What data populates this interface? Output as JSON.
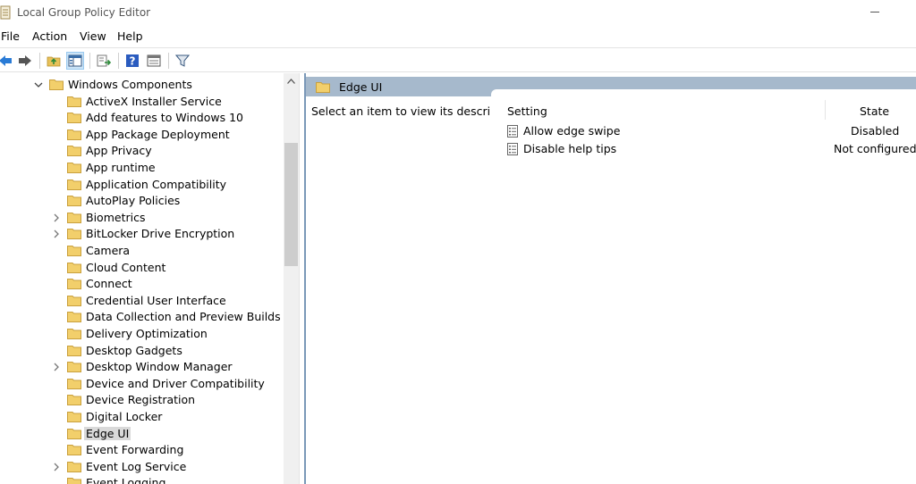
{
  "window": {
    "title": "Local Group Policy Editor"
  },
  "menu": [
    "File",
    "Action",
    "View",
    "Help"
  ],
  "toolbar": {
    "buttons": [
      "back-icon",
      "forward-icon",
      "up-folder-icon",
      "show-hide-tree-icon",
      "export-list-icon",
      "help-icon",
      "properties-icon",
      "filter-icon"
    ]
  },
  "tree": {
    "items": [
      {
        "label": "Windows Components",
        "expander": "expanded"
      },
      {
        "label": "ActiveX Installer Service",
        "expander": "none"
      },
      {
        "label": "Add features to Windows 10",
        "expander": "none"
      },
      {
        "label": "App Package Deployment",
        "expander": "none"
      },
      {
        "label": "App Privacy",
        "expander": "none"
      },
      {
        "label": "App runtime",
        "expander": "none"
      },
      {
        "label": "Application Compatibility",
        "expander": "none"
      },
      {
        "label": "AutoPlay Policies",
        "expander": "none"
      },
      {
        "label": "Biometrics",
        "expander": "collapsed"
      },
      {
        "label": "BitLocker Drive Encryption",
        "expander": "collapsed"
      },
      {
        "label": "Camera",
        "expander": "none"
      },
      {
        "label": "Cloud Content",
        "expander": "none"
      },
      {
        "label": "Connect",
        "expander": "none"
      },
      {
        "label": "Credential User Interface",
        "expander": "none"
      },
      {
        "label": "Data Collection and Preview Builds",
        "expander": "none"
      },
      {
        "label": "Delivery Optimization",
        "expander": "none"
      },
      {
        "label": "Desktop Gadgets",
        "expander": "none"
      },
      {
        "label": "Desktop Window Manager",
        "expander": "collapsed"
      },
      {
        "label": "Device and Driver Compatibility",
        "expander": "none"
      },
      {
        "label": "Device Registration",
        "expander": "none"
      },
      {
        "label": "Digital Locker",
        "expander": "none"
      },
      {
        "label": "Edge UI",
        "expander": "none",
        "selected": true
      },
      {
        "label": "Event Forwarding",
        "expander": "none"
      },
      {
        "label": "Event Log Service",
        "expander": "collapsed"
      },
      {
        "label": "Event Logging",
        "expander": "none"
      }
    ]
  },
  "details": {
    "header": "Edge UI",
    "description": "Select an item to view its description.",
    "columns": {
      "setting": "Setting",
      "state": "State"
    },
    "rows": [
      {
        "name": "Allow edge swipe",
        "state": "Disabled"
      },
      {
        "name": "Disable help tips",
        "state": "Not configured"
      }
    ]
  },
  "colors": {
    "accent": "#a6b9cc",
    "folder": "#e8c15a",
    "selection": "#d9d9d9"
  }
}
